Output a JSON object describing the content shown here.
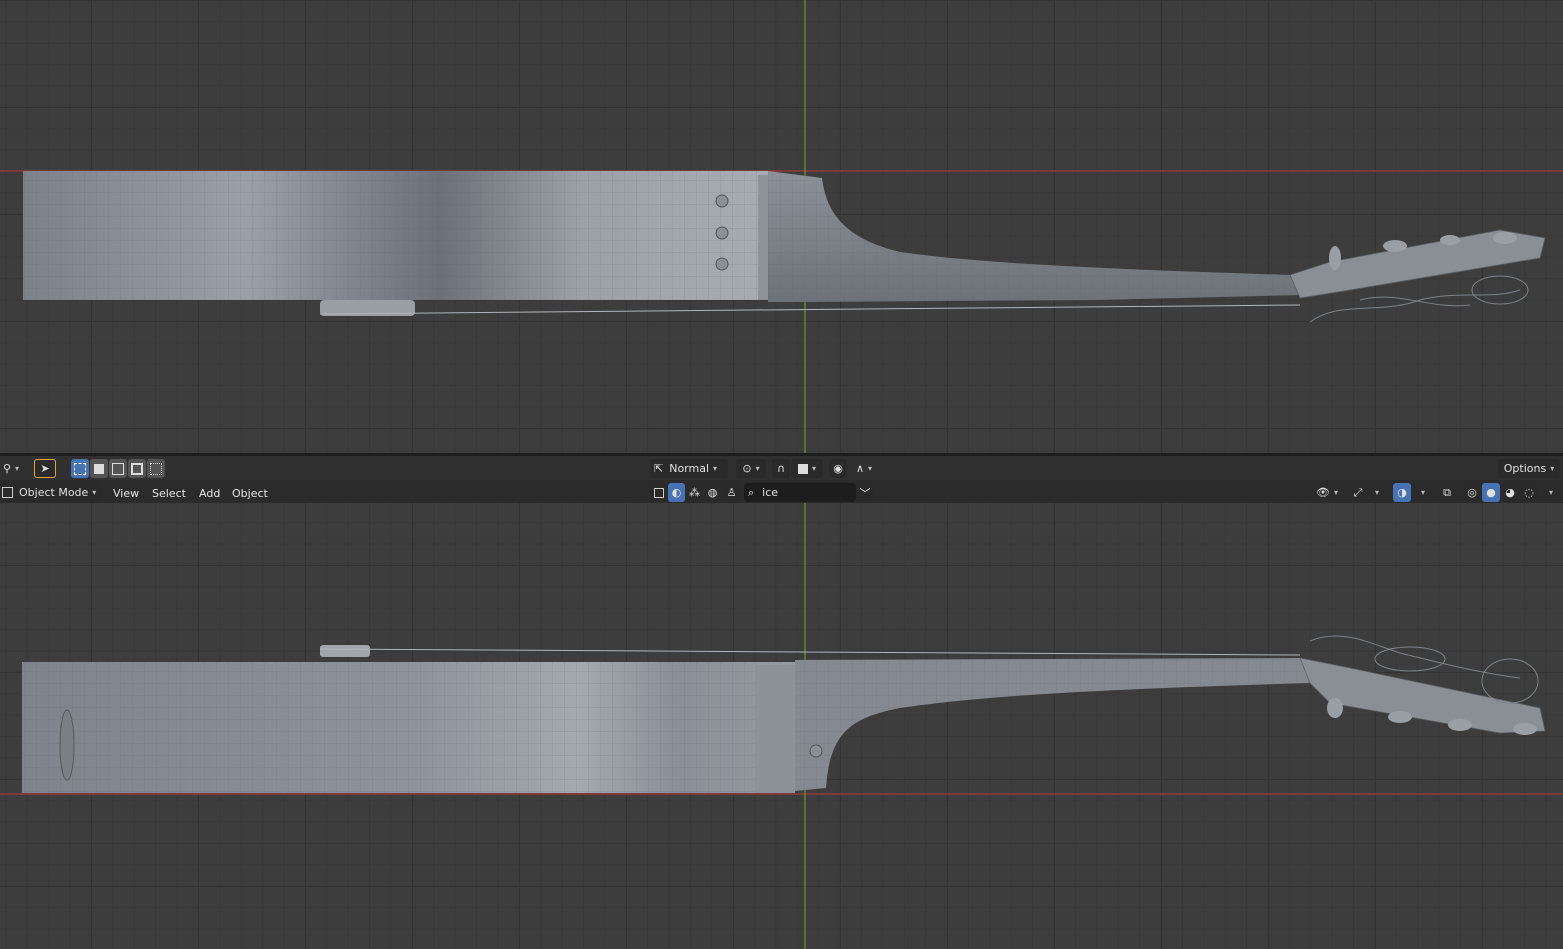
{
  "toolbar": {
    "transform_orientation": "Normal",
    "options_label": "Options",
    "select_modes": [
      "select-box-set",
      "select-box-extend",
      "select-box-subtract",
      "select-box-invert",
      "select-box-intersect"
    ]
  },
  "header": {
    "mode_label": "Object Mode",
    "menus": [
      "View",
      "Select",
      "Add",
      "Object"
    ],
    "search_value": "ice"
  },
  "colors": {
    "viewport_bg": "#3d3d3d",
    "x_axis": "#a33b3b",
    "y_axis": "#6c9a2c",
    "header_bg": "#2b2b2b",
    "toolbar_bg": "#303030",
    "active_blue": "#4772b3",
    "select_tool_outline": "#e8a13a"
  },
  "icons": {
    "select_tool": "cursor-arrow-icon",
    "transform": "transform-orientation-icon",
    "pivot": "pivot-point-icon",
    "snap": "magnet-icon",
    "proportional": "proportional-edit-icon",
    "falloff": "falloff-curve-icon",
    "search": "search-icon",
    "visibility": "eye-icon",
    "gizmo": "gizmo-icon",
    "overlay": "overlay-icon",
    "xray": "xray-icon",
    "shading": [
      "wireframe-shading-icon",
      "solid-shading-icon",
      "material-shading-icon",
      "rendered-shading-icon"
    ]
  }
}
